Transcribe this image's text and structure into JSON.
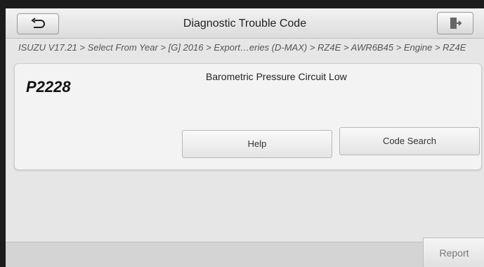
{
  "header": {
    "title": "Diagnostic Trouble Code",
    "back_icon": "back-arrow-icon",
    "exit_icon": "exit-door-icon"
  },
  "breadcrumb": "ISUZU V17.21 > Select From Year > [G] 2016 > Export…eries (D-MAX) > RZ4E > AWR6B45 > Engine > RZ4E",
  "dtc": {
    "code": "P2228",
    "description": "Barometric Pressure Circuit Low"
  },
  "buttons": {
    "help": "Help",
    "code_search": "Code Search"
  },
  "footer": {
    "report": "Report"
  },
  "colors": {
    "background": "#e6e6e6",
    "titlebar": "#dcdcdc",
    "text": "#222222"
  }
}
